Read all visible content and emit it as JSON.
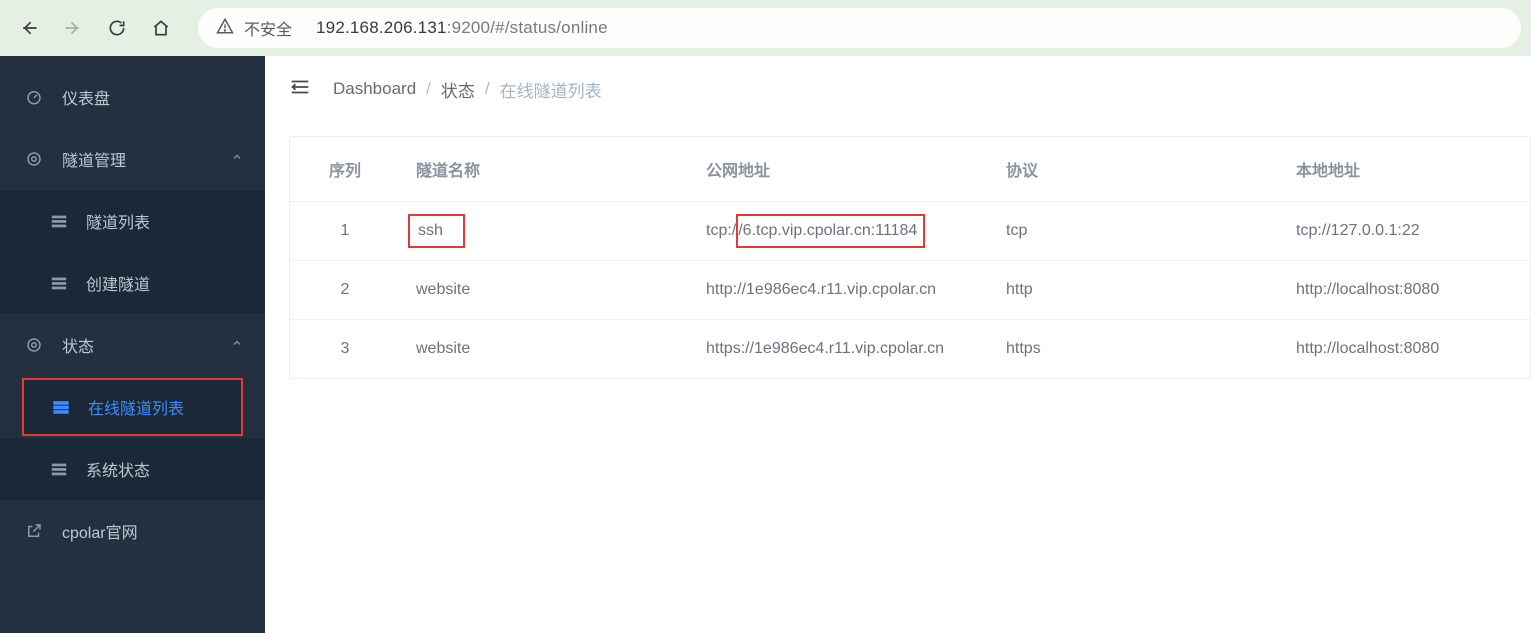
{
  "browser": {
    "insecure_label": "不安全",
    "url_host": "192.168.206.131",
    "url_port_path": ":9200/#/status/online"
  },
  "sidebar": {
    "dashboard": "仪表盘",
    "tunnel_mgmt": "隧道管理",
    "tunnel_list": "隧道列表",
    "create_tunnel": "创建隧道",
    "status": "状态",
    "online_list": "在线隧道列表",
    "system_status": "系统状态",
    "official_site": "cpolar官网"
  },
  "breadcrumb": {
    "dashboard": "Dashboard",
    "status": "状态",
    "current": "在线隧道列表"
  },
  "table": {
    "headers": {
      "seq": "序列",
      "name": "隧道名称",
      "public": "公网地址",
      "proto": "协议",
      "local": "本地地址"
    },
    "rows": [
      {
        "seq": "1",
        "name": "ssh",
        "public_pre": "tcp:/",
        "public_boxed": "/6.tcp.vip.cpolar.cn:11184",
        "proto": "tcp",
        "local": "tcp://127.0.0.1:22",
        "highlight": true
      },
      {
        "seq": "2",
        "name": "website",
        "public_full": "http://1e986ec4.r11.vip.cpolar.cn",
        "proto": "http",
        "local": "http://localhost:8080"
      },
      {
        "seq": "3",
        "name": "website",
        "public_full": "https://1e986ec4.r11.vip.cpolar.cn",
        "proto": "https",
        "local": "http://localhost:8080"
      }
    ]
  }
}
